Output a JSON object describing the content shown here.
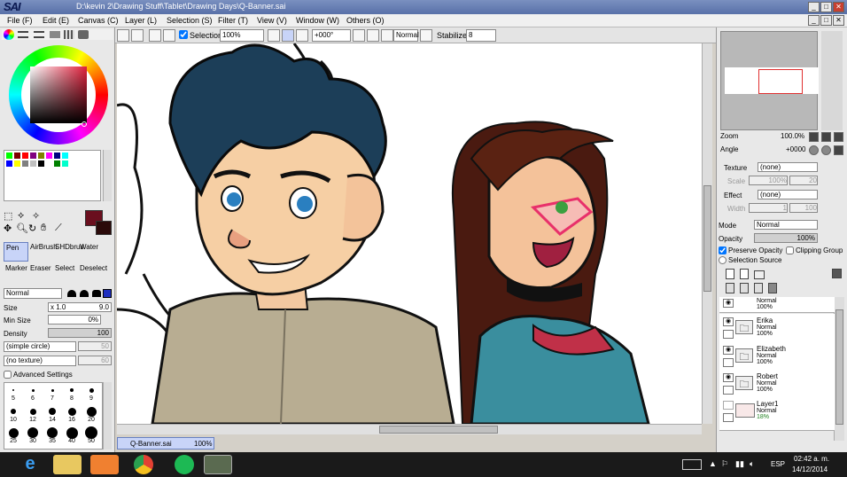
{
  "window": {
    "app_logo": "PaintTool SAI",
    "title": "D:\\kevin 2\\Drawing Stuff\\Tablet\\Drawing Days\\Q-Banner.sai"
  },
  "menu": [
    {
      "label": "File (F)"
    },
    {
      "label": "Edit (E)"
    },
    {
      "label": "Canvas (C)"
    },
    {
      "label": "Layer (L)"
    },
    {
      "label": "Selection (S)"
    },
    {
      "label": "Filter (T)"
    },
    {
      "label": "View (V)"
    },
    {
      "label": "Window (W)"
    },
    {
      "label": "Others (O)"
    }
  ],
  "toolbar": {
    "selection_label": "Selection",
    "zoom": "100%",
    "angle": "+000°",
    "blend": "Normal",
    "stabilizer_label": "Stabilizer",
    "stabilizer": "8"
  },
  "color": {
    "current": "#6a0f1e",
    "background": "#2a0a0a"
  },
  "palette": [
    "#00ff00",
    "#7f0000",
    "#ff0000",
    "#800080",
    "#808000",
    "#ff00ff",
    "#000080",
    "#00ffff",
    "#0000ff",
    "#ffff00",
    "#808080",
    "#c0c0c0",
    "#000000",
    "#ffffff",
    "#008000",
    "#00ffcc"
  ],
  "tools": {
    "row1": [
      "Pen",
      "AirBrush",
      "SHDbrus",
      "Water"
    ],
    "row2": [
      "Marker",
      "Eraser",
      "Select",
      "Deselect"
    ]
  },
  "brush": {
    "blend": "Normal",
    "size_label": "Size",
    "size_mult": "x 1.0",
    "size": "9.0",
    "min_size_label": "Min Size",
    "min_size": "0%",
    "density_label": "Density",
    "density": "100",
    "shape": "(simple circle)",
    "shape_val": "50",
    "texture": "(no texture)",
    "texture_val": "60",
    "advanced_label": "Advanced Settings"
  },
  "brush_sizes": [
    {
      "label": "5"
    },
    {
      "label": "6"
    },
    {
      "label": "7"
    },
    {
      "label": "8"
    },
    {
      "label": "9"
    },
    {
      "label": "10"
    },
    {
      "label": "12"
    },
    {
      "label": "14"
    },
    {
      "label": "16"
    },
    {
      "label": "20"
    },
    {
      "label": "25"
    },
    {
      "label": "30"
    },
    {
      "label": "35"
    },
    {
      "label": "40"
    },
    {
      "label": "50"
    }
  ],
  "navigator": {
    "zoom_label": "Zoom",
    "zoom": "100.0%",
    "angle_label": "Angle",
    "angle": "+0000"
  },
  "layer_props": {
    "texture_label": "Texture",
    "texture": "(none)",
    "scale_label": "Scale",
    "scale": "100%",
    "scale_val": "20",
    "effect_label": "Effect",
    "effect": "(none)",
    "width_label": "Width",
    "width": "1",
    "width_val": "100",
    "mode_label": "Mode",
    "mode": "Normal",
    "opacity_label": "Opacity",
    "opacity": "100%",
    "preserve_opacity": "Preserve Opacity",
    "clipping_group": "Clipping Group",
    "selection_source": "Selection Source"
  },
  "layers": [
    {
      "name": "",
      "mode": "Normal",
      "opacity": "100%"
    },
    {
      "name": "Erika",
      "mode": "Normal",
      "opacity": "100%"
    },
    {
      "name": "Elizabeth",
      "mode": "Normal",
      "opacity": "100%"
    },
    {
      "name": "Robert",
      "mode": "Normal",
      "opacity": "100%"
    },
    {
      "name": "Layer1",
      "mode": "Normal",
      "opacity": "18%"
    }
  ],
  "doc_tab": {
    "name": "Q-Banner.sai",
    "zoom": "100%"
  },
  "tray": {
    "lang": "ESP",
    "time": "02:42 a. m.",
    "date": "14/12/2014"
  }
}
